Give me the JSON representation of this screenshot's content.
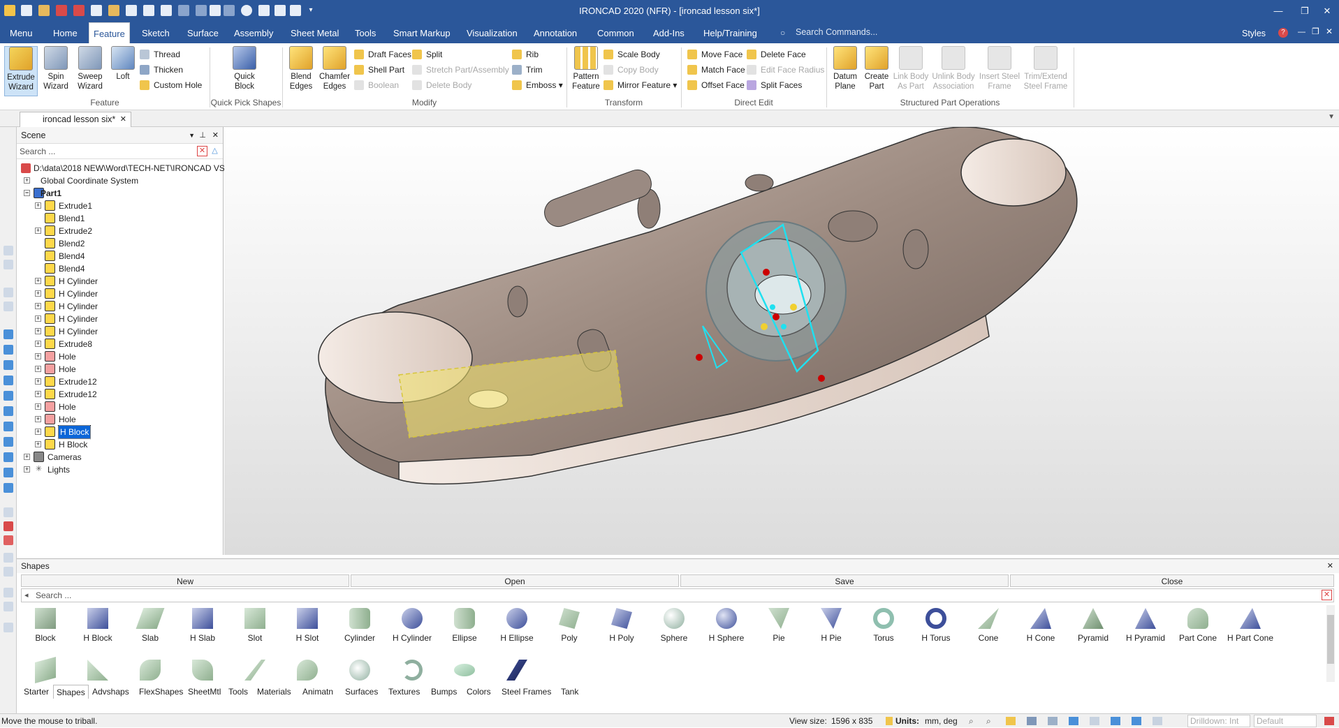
{
  "window": {
    "title": "IRONCAD 2020 (NFR) - [ironcad lesson six*]"
  },
  "menu": {
    "tabs": [
      "Menu",
      "Home",
      "Feature",
      "Sketch",
      "Surface",
      "Assembly",
      "Sheet Metal",
      "Tools",
      "Smart Markup",
      "Visualization",
      "Annotation",
      "Common",
      "Add-Ins",
      "Help/Training"
    ],
    "active": "Feature",
    "search_placeholder": "Search Commands...",
    "styles": "Styles"
  },
  "ribbon": {
    "feature": {
      "extrude": "Extrude Wizard",
      "spin": "Spin Wizard",
      "sweep": "Sweep Wizard",
      "loft": "Loft",
      "thread": "Thread",
      "thicken": "Thicken",
      "custom_hole": "Custom Hole",
      "label": "Feature"
    },
    "quick": {
      "block": "Quick Block",
      "label": "Quick Pick Shapes"
    },
    "modify": {
      "blend": "Blend Edges",
      "chamfer": "Chamfer Edges",
      "draft": "Draft Faces",
      "shell": "Shell Part",
      "boolean": "Boolean",
      "split": "Split",
      "stretch": "Stretch Part/Assembly",
      "delete_body": "Delete Body",
      "rib": "Rib",
      "trim": "Trim",
      "emboss": "Emboss",
      "label": "Modify"
    },
    "transform": {
      "pattern": "Pattern Feature",
      "scale": "Scale Body",
      "copy": "Copy Body",
      "mirror": "Mirror Feature",
      "label": "Transform"
    },
    "direct": {
      "move": "Move Face",
      "match": "Match Face",
      "offset": "Offset Face",
      "delete": "Delete Face",
      "edit_radius": "Edit Face Radius",
      "split_faces": "Split Faces",
      "label": "Direct Edit"
    },
    "spo": {
      "datum": "Datum Plane",
      "create": "Create Part",
      "link": "Link Body As Part",
      "unlink": "Unlink Body Association",
      "insert": "Insert Steel Frame",
      "trim": "Trim/Extend Steel Frame",
      "label": "Structured Part Operations"
    }
  },
  "doc_tab": "ironcad lesson six*",
  "scene": {
    "title": "Scene",
    "search": "Search ...",
    "root": "D:\\data\\2018 NEW\\Word\\TECH-NET\\IRONCAD VS",
    "items": [
      "Global Coordinate System",
      "Part1",
      "Extrude1",
      "Blend1",
      "Extrude2",
      "Blend2",
      "Blend4",
      "Blend4",
      "H Cylinder",
      "H Cylinder",
      "H Cylinder",
      "H Cylinder",
      "H Cylinder",
      "Extrude8",
      "Hole",
      "Hole",
      "Extrude12",
      "Extrude12",
      "Hole",
      "Hole",
      "H Block",
      "H Block",
      "Cameras",
      "Lights"
    ]
  },
  "shapes": {
    "title": "Shapes",
    "buttons": [
      "New",
      "Open",
      "Save",
      "Close"
    ],
    "search": "Search ...",
    "items": [
      "Block",
      "H Block",
      "Slab",
      "H Slab",
      "Slot",
      "H Slot",
      "Cylinder",
      "H Cylinder",
      "Ellipse",
      "H Ellipse",
      "Poly",
      "H Poly",
      "Sphere",
      "H Sphere",
      "Pie",
      "H Pie",
      "Torus",
      "H Torus",
      "Cone",
      "H Cone",
      "Pyramid",
      "H Pyramid",
      "Part Cone",
      "H Part Cone"
    ],
    "tabs": [
      "Starter",
      "Shapes",
      "Advshaps",
      "FlexShapes",
      "SheetMtl",
      "Tools",
      "Materials",
      "Animatn",
      "Surfaces",
      "Textures",
      "Bumps",
      "Colors",
      "Steel Frames",
      "Tank"
    ],
    "active_tab": "Shapes"
  },
  "status": {
    "message": "Move the mouse to triball.",
    "view_size_label": "View size:",
    "view_size": "1596 x 835",
    "units_label": "Units:",
    "units": "mm, deg",
    "drilldown": "Drilldown: Int",
    "default": "Default"
  }
}
